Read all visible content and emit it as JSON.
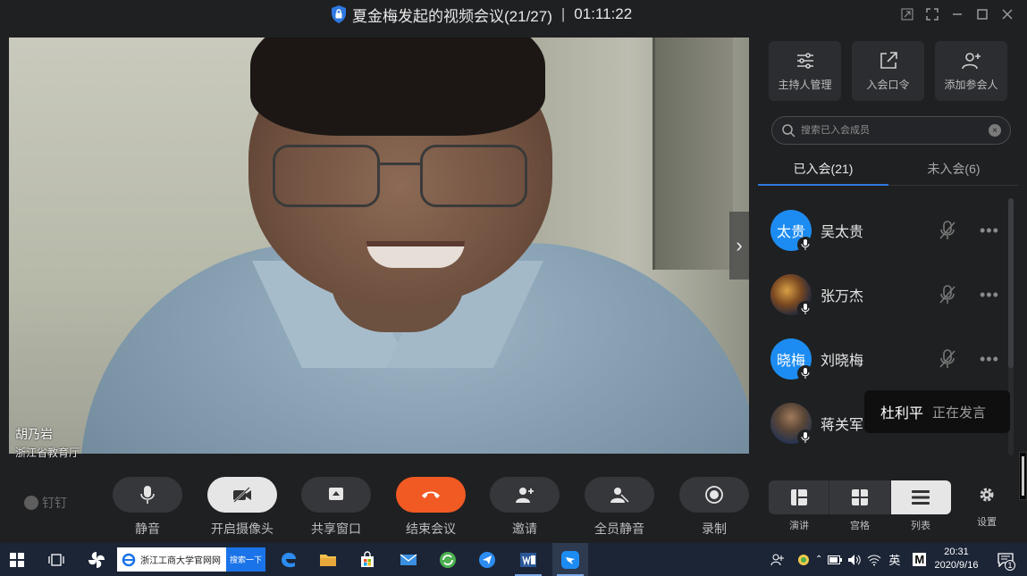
{
  "window": {
    "title": "夏金梅发起的视频会议(21/27)",
    "separator": "|",
    "timer": "01:11:22"
  },
  "video": {
    "speaker_name": "胡乃岩",
    "speaker_org": "浙江省教育厅"
  },
  "panel": {
    "top_buttons": [
      {
        "label": "主持人管理",
        "icon": "sliders-icon"
      },
      {
        "label": "入会口令",
        "icon": "share-out-icon"
      },
      {
        "label": "添加参会人",
        "icon": "add-user-icon"
      }
    ],
    "search_placeholder": "搜索已入会成员",
    "tabs": [
      {
        "label": "已入会(21)",
        "active": true
      },
      {
        "label": "未入会(6)",
        "active": false
      }
    ],
    "members": [
      {
        "avatar_text": "太贵",
        "name": "吴太贵"
      },
      {
        "avatar_text": "",
        "name": "张万杰"
      },
      {
        "avatar_text": "晓梅",
        "name": "刘晓梅"
      },
      {
        "avatar_text": "",
        "name": "蒋关军"
      }
    ],
    "speaking": {
      "name": "杜利平",
      "status": "正在发言"
    }
  },
  "controls": {
    "logo": "钉钉",
    "buttons": [
      {
        "label": "静音",
        "icon": "microphone-icon"
      },
      {
        "label": "开启摄像头",
        "icon": "camera-off-icon"
      },
      {
        "label": "共享窗口",
        "icon": "share-screen-icon"
      },
      {
        "label": "结束会议",
        "icon": "hang-up-icon"
      },
      {
        "label": "邀请",
        "icon": "invite-user-icon"
      },
      {
        "label": "全员静音",
        "icon": "mute-all-icon"
      },
      {
        "label": "录制",
        "icon": "record-icon"
      }
    ],
    "views": [
      {
        "label": "演讲",
        "active": false
      },
      {
        "label": "宫格",
        "active": false
      },
      {
        "label": "列表",
        "active": true
      }
    ],
    "settings_label": "设置"
  },
  "taskbar": {
    "search_text": "浙江工商大学官网网",
    "search_button": "搜索一下",
    "ime": "英",
    "ime_mode": "M",
    "time": "20:31",
    "date": "2020/9/16",
    "notification_count": "1"
  },
  "colors": {
    "accent": "#2f78e0",
    "end_call": "#f15a22",
    "avatar_blue": "#1d8cf2"
  }
}
